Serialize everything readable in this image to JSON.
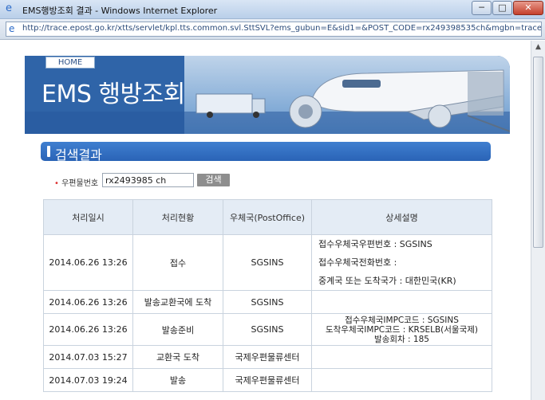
{
  "window": {
    "title": "EMS행방조회 결과 - Windows Internet Explorer",
    "minimize": "─",
    "maximize": "□",
    "close": "✕"
  },
  "address": {
    "url": "http://trace.epost.go.kr/xtts/servlet/kpl.tts.common.svl.SttSVL?ems_gubun=E&sid1=&POST_CODE=rx249398535ch&mgbn=trace&traces"
  },
  "banner": {
    "home": "HOME",
    "title": "EMS 행방조회"
  },
  "section": {
    "title": "검색결과"
  },
  "search": {
    "label": "우편물번호",
    "value": "rx2493985 ch",
    "button": "검색"
  },
  "table": {
    "headers": [
      "처리일시",
      "처리현황",
      "우체국(PostOffice)",
      "상세설명"
    ],
    "rows": [
      {
        "datetime": "2014.06.26 13:26",
        "status": "접수",
        "office": "SGSINS",
        "details": [
          "접수우체국우편번호 : SGSINS",
          "접수우체국전화번호 :",
          "중계국 또는 도착국가 : 대한민국(KR)"
        ]
      },
      {
        "datetime": "2014.06.26 13:26",
        "status": "발송교환국에 도착",
        "office": "SGSINS",
        "details": []
      },
      {
        "datetime": "2014.06.26 13:26",
        "status": "발송준비",
        "office": "SGSINS",
        "details": [
          "접수우체국IMPC코드 : SGSINS",
          "도착우체국IMPC코드 : KRSELB(서울국제)",
          "발송회차 : 185"
        ]
      },
      {
        "datetime": "2014.07.03 15:27",
        "status": "교환국 도착",
        "office": "국제우편물류센터",
        "details": []
      },
      {
        "datetime": "2014.07.03 19:24",
        "status": "발송",
        "office": "국제우편물류센터",
        "details": []
      }
    ]
  }
}
